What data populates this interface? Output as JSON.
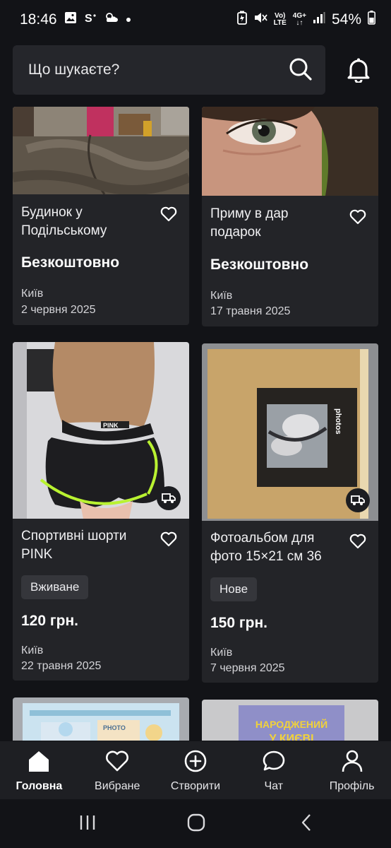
{
  "status_bar": {
    "time": "18:46",
    "battery": "54%",
    "net_top": "Vo)",
    "net_bottom": "LTE",
    "gen_top": "4G+",
    "gen_bottom": "↓↑"
  },
  "search": {
    "placeholder": "Що шукаєте?"
  },
  "listings": [
    {
      "title": "Будинок у Подільському",
      "price": "Безкоштовно",
      "city": "Київ",
      "date": "2 червня 2025"
    },
    {
      "title": "Приму в дар подарок",
      "price": "Безкоштовно",
      "city": "Київ",
      "date": "17 травня 2025"
    },
    {
      "title": "Спортивні шорти PINK",
      "condition": "Вживане",
      "price": "120 грн.",
      "city": "Київ",
      "date": "22 травня 2025",
      "delivery": true
    },
    {
      "title": "Фотоальбом для фото 15×21 см 36",
      "condition": "Нове",
      "price": "150 грн.",
      "city": "Київ",
      "date": "7 червня 2025",
      "delivery": true,
      "image_text": "photos"
    }
  ],
  "partial_images": {
    "left_text": "PHOTO",
    "right_line1": "НАРОДЖЕНИЙ",
    "right_line2": "У КИЄВІ"
  },
  "bottom_nav": [
    {
      "label": "Головна",
      "icon": "home-icon",
      "active": true
    },
    {
      "label": "Вибране",
      "icon": "heart-icon",
      "active": false
    },
    {
      "label": "Створити",
      "icon": "plus-circle-icon",
      "active": false
    },
    {
      "label": "Чат",
      "icon": "chat-icon",
      "active": false
    },
    {
      "label": "Профіль",
      "icon": "user-icon",
      "active": false
    }
  ],
  "colors": {
    "background": "#121317",
    "card": "#232428",
    "search_bg": "#25262b",
    "nav_bg": "#1e1f23",
    "badge_bg": "#35363b",
    "text": "#ffffff"
  }
}
